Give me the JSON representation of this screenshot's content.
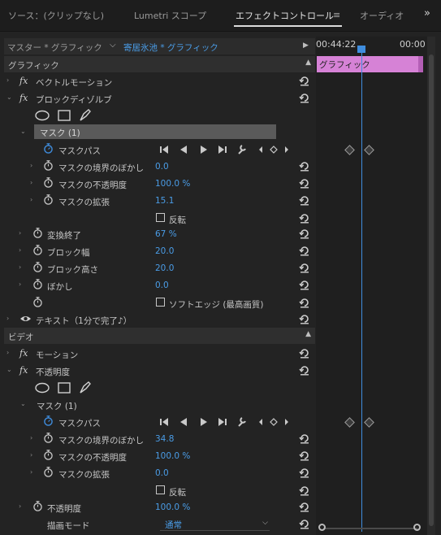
{
  "tabs": [
    {
      "label": "ソース：(クリップなし)"
    },
    {
      "label": "Lumetri スコープ"
    },
    {
      "label": "エフェクトコントロール"
    },
    {
      "label": "オーディオ"
    }
  ],
  "source_row": {
    "master": "マスター * グラフィック",
    "clip": "寄居氷池 * グラフィック"
  },
  "timeline": {
    "timecode_start": "00:44:22",
    "timecode_end": "00:00",
    "clip_label": "グラフィック"
  },
  "sections": {
    "graphic": "グラフィック",
    "video": "ビデオ"
  },
  "graphic": {
    "vector_motion": "ベクトルモーション",
    "block_dissolve": "ブロックディゾルブ",
    "mask_label": "マスク (1)",
    "mask_path": "マスクパス",
    "mask_feather": {
      "label": "マスクの境界のぼかし",
      "value": "0.0"
    },
    "mask_opacity": {
      "label": "マスクの不透明度",
      "value": "100.0 %"
    },
    "mask_expansion": {
      "label": "マスクの拡張",
      "value": "15.1"
    },
    "invert": "反転",
    "transition_complete": {
      "label": "変換終了",
      "value": "67 %"
    },
    "block_width": {
      "label": "ブロック幅",
      "value": "20.0"
    },
    "block_height": {
      "label": "ブロック高さ",
      "value": "20.0"
    },
    "blur": {
      "label": "ぼかし",
      "value": "0.0"
    },
    "soft_edges": "ソフトエッジ (最高画質)",
    "text_layer": "テキスト（1分で完了♪）"
  },
  "video": {
    "motion": "モーション",
    "opacity_fx": "不透明度",
    "mask_label": "マスク (1)",
    "mask_path": "マスクパス",
    "mask_feather": {
      "label": "マスクの境界のぼかし",
      "value": "34.8"
    },
    "mask_opacity": {
      "label": "マスクの不透明度",
      "value": "100.0 %"
    },
    "mask_expansion": {
      "label": "マスクの拡張",
      "value": "0.0"
    },
    "invert": "反転",
    "opacity": {
      "label": "不透明度",
      "value": "100.0 %"
    },
    "blend_mode": {
      "label": "描画モード",
      "value": "通常"
    }
  },
  "colors": {
    "value_blue": "#4a9ce6",
    "playhead": "#3f8dde",
    "clip_pink": "#d682d6"
  }
}
